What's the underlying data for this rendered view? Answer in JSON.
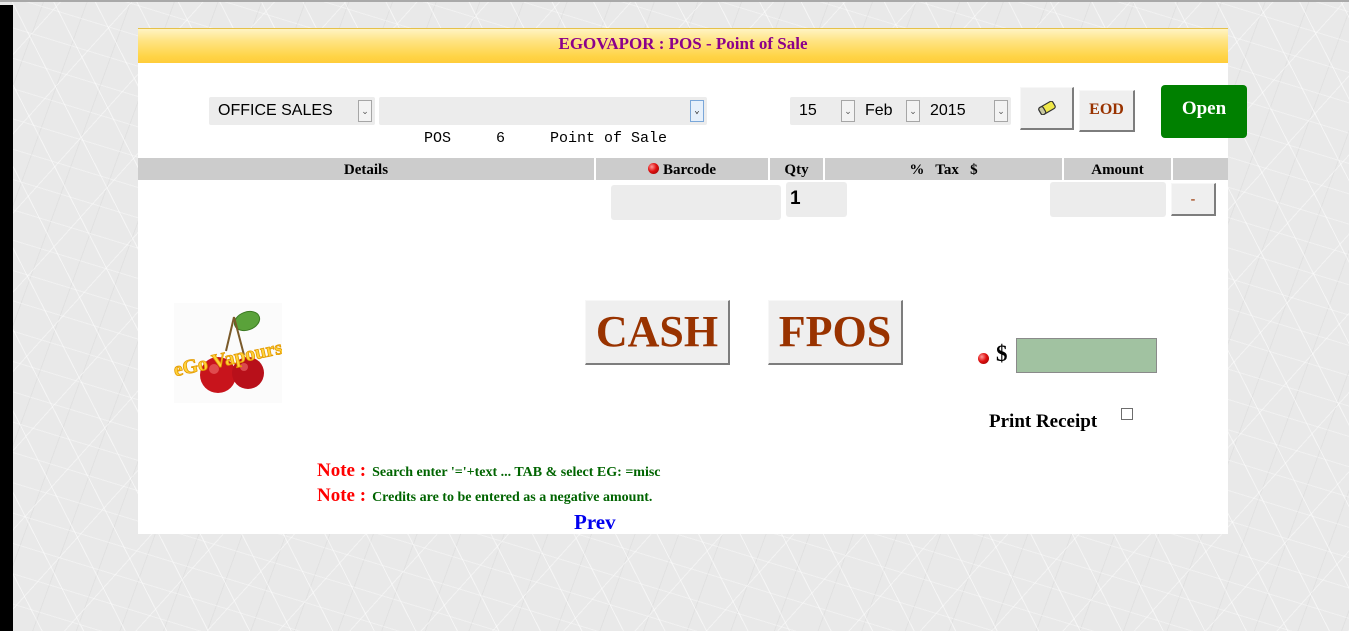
{
  "page": {
    "title": "EGOVAPOR : POS - Point of Sale"
  },
  "toolbar": {
    "department": {
      "selected": "OFFICE SALES"
    },
    "terminal": {
      "selected": "POS     6     Point of Sale"
    },
    "date": {
      "day": "15",
      "month": "Feb",
      "year": "2015"
    },
    "clear_icon": "eraser-icon",
    "eod_label": "EOD",
    "open_label": "Open",
    "open_color": "#008000"
  },
  "table": {
    "columns": [
      "Details",
      "Barcode",
      "Qty",
      "%   Tax   $",
      "Amount",
      ""
    ],
    "row": {
      "barcode": "",
      "qty": "1",
      "amount": "",
      "remove_label": "-"
    }
  },
  "logo": {
    "text": "eGo Vapours"
  },
  "payment": {
    "cash_label": "CASH",
    "fpos_label": "FPOS",
    "currency_symbol": "$",
    "amount": "",
    "print_receipt_label": "Print Receipt",
    "print_receipt_checked": false
  },
  "notes": [
    {
      "label": "Note :",
      "text": "Search enter '='+text ... TAB & select EG: =misc"
    },
    {
      "label": "Note :",
      "text": "Credits are to be entered as a negative amount."
    }
  ],
  "nav": {
    "prev_label": "Prev"
  },
  "colors": {
    "title": "#8b008b",
    "button_text": "#993300",
    "note_label": "#ff0000",
    "note_text": "#006400",
    "link": "#0000ee",
    "amount_field": "#a1c2a1"
  }
}
